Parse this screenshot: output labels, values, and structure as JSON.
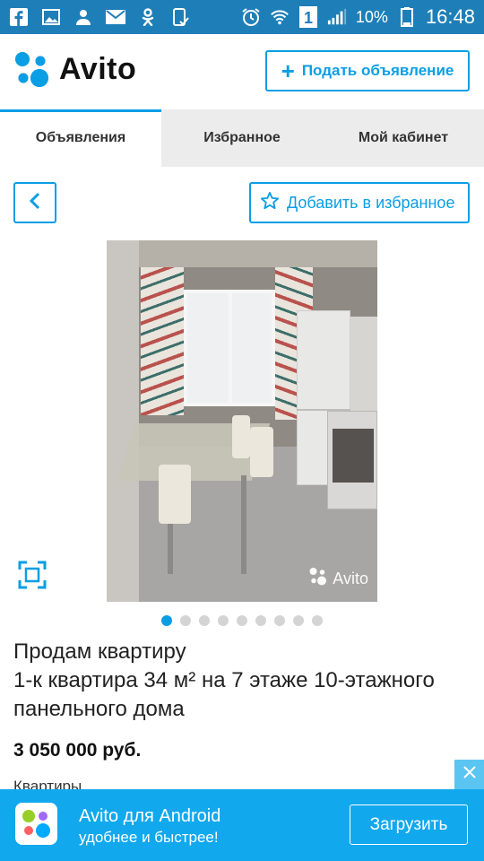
{
  "status_bar": {
    "battery_percent": "10%",
    "time": "16:48",
    "left_icons": [
      "facebook-icon",
      "gallery-icon",
      "contact-icon",
      "mail-icon",
      "odnoklassniki-icon",
      "phone-check-icon"
    ],
    "right_icons": [
      "alarm-icon",
      "wifi-icon",
      "sim-1-icon",
      "signal-icon",
      "battery-icon"
    ]
  },
  "header": {
    "logo_text": "Avito",
    "post_ad_label": "Подать объявление"
  },
  "tabs": [
    {
      "label": "Объявления",
      "active": true
    },
    {
      "label": "Избранное",
      "active": false
    },
    {
      "label": "Мой кабинет",
      "active": false
    }
  ],
  "nav": {
    "add_favorite_label": "Добавить в избранное"
  },
  "gallery": {
    "watermark": "Avito",
    "photo_count": 9,
    "active_index": 0
  },
  "listing": {
    "title_line1": "Продам квартиру",
    "title_line2": "1-к квартира 34 м² на 7 этаже 10-этажного панельного дома",
    "price": "3 050 000 руб.",
    "category": "Квартиры"
  },
  "banner": {
    "title": "Avito для Android",
    "subtitle": "удобнее и быстрее!",
    "download_label": "Загрузить"
  },
  "colors": {
    "status_bar": "#1e7fb8",
    "accent": "#0a9ee5",
    "banner": "#12a8ee",
    "tabs_bg": "#ececec"
  }
}
